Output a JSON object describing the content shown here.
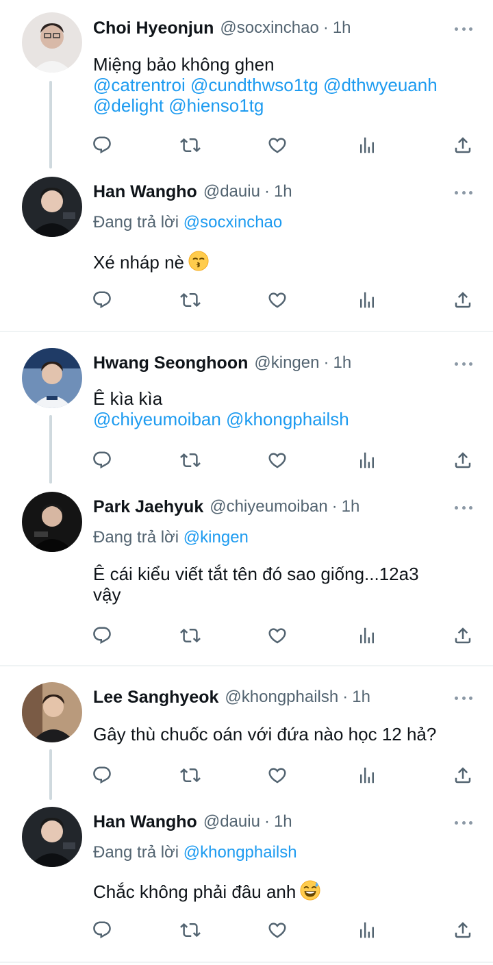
{
  "threads": [
    {
      "tweets": [
        {
          "name": "Choi Hyeonjun",
          "handle": "@socxinchao",
          "dot": "·",
          "time": "1h",
          "text_lines": [
            "Miệng bảo không ghen",
            "@catrentroi @cundthwso1tg @dthwyeuanh",
            "@delight @hienso1tg"
          ],
          "avatar": "avatar-photo-light"
        },
        {
          "name": "Han Wangho",
          "handle": "@dauiu",
          "dot": "·",
          "time": "1h",
          "replying_prefix": "Đang trả lời ",
          "replying_to": "@socxinchao",
          "text": "Xé nháp nè",
          "emoji": "kissing-face-emoji",
          "avatar": "avatar-photo-dark"
        }
      ]
    },
    {
      "tweets": [
        {
          "name": "Hwang Seonghoon",
          "handle": "@kingen",
          "dot": "·",
          "time": "1h",
          "text_lines": [
            "Ê kìa kìa",
            "@chiyeumoiban @khongphailsh"
          ],
          "avatar": "avatar-photo-blue"
        },
        {
          "name": "Park Jaehyuk",
          "handle": "@chiyeumoiban",
          "dot": "·",
          "time": "1h",
          "replying_prefix": "Đang trả lời ",
          "replying_to": "@kingen",
          "text_lines": [
            "Ê cái kiểu viết tắt tên đó sao giống...12a3",
            "vậy"
          ],
          "avatar": "avatar-photo-night"
        }
      ]
    },
    {
      "tweets": [
        {
          "name": "Lee Sanghyeok",
          "handle": "@khongphailsh",
          "dot": "·",
          "time": "1h",
          "text": "Gây thù chuốc oán với đứa nào học 12 hả?",
          "avatar": "avatar-photo-warm"
        },
        {
          "name": "Han Wangho",
          "handle": "@dauiu",
          "dot": "·",
          "time": "1h",
          "replying_prefix": "Đang trả lời ",
          "replying_to": "@khongphailsh",
          "text": "Chắc không phải đâu anh",
          "emoji": "grinning-sweat-emoji",
          "avatar": "avatar-photo-dark"
        }
      ]
    }
  ],
  "action_icons": [
    "reply-icon",
    "retweet-icon",
    "like-icon",
    "analytics-icon",
    "share-icon"
  ],
  "colors": {
    "text": "#0f1419",
    "secondary": "#536471",
    "mention": "#1d9bf0",
    "thread_line": "#cfd9de",
    "divider": "#eff3f4"
  }
}
